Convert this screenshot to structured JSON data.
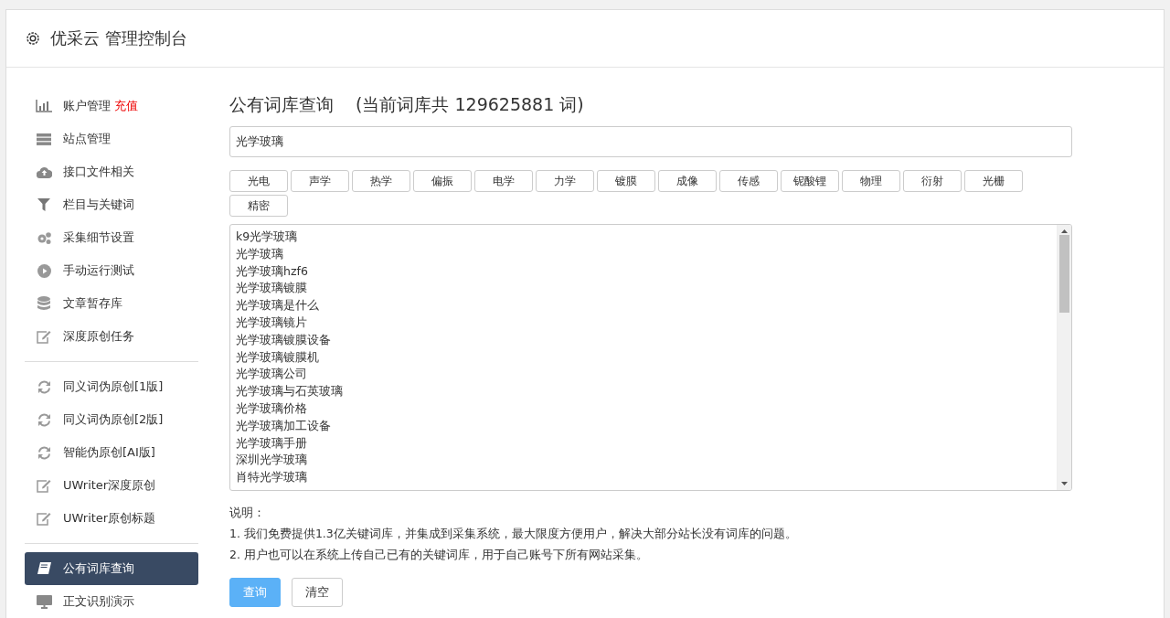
{
  "header": {
    "title": "优采云 管理控制台"
  },
  "sidebar": {
    "groups": [
      {
        "items": [
          {
            "kind": "chart",
            "label": "账户管理",
            "badge": "充值",
            "selected": false
          },
          {
            "kind": "server",
            "label": "站点管理",
            "selected": false
          },
          {
            "kind": "cloud",
            "label": "接口文件相关",
            "selected": false
          },
          {
            "kind": "filter",
            "label": "栏目与关键词",
            "selected": false
          },
          {
            "kind": "gears",
            "label": "采集细节设置",
            "selected": false
          },
          {
            "kind": "play",
            "label": "手动运行测试",
            "selected": false
          },
          {
            "kind": "db",
            "label": "文章暂存库",
            "selected": false
          },
          {
            "kind": "edit",
            "label": "深度原创任务",
            "selected": false
          }
        ]
      },
      {
        "items": [
          {
            "kind": "refresh",
            "label": "同义词伪原创[1版]",
            "selected": false
          },
          {
            "kind": "refresh",
            "label": "同义词伪原创[2版]",
            "selected": false
          },
          {
            "kind": "refresh",
            "label": "智能伪原创[AI版]",
            "selected": false
          },
          {
            "kind": "edit",
            "label": "UWriter深度原创",
            "selected": false
          },
          {
            "kind": "edit",
            "label": "UWriter原创标题",
            "selected": false
          }
        ]
      },
      {
        "items": [
          {
            "kind": "book",
            "label": "公有词库查询",
            "selected": true
          },
          {
            "kind": "monitor",
            "label": "正文识别演示",
            "selected": false
          }
        ]
      }
    ]
  },
  "main": {
    "title": "公有词库查询",
    "subtitle": "(当前词库共 129625881 词)",
    "search": {
      "value": "光学玻璃"
    },
    "tags": [
      "光电",
      "声学",
      "热学",
      "偏振",
      "电学",
      "力学",
      "镀膜",
      "成像",
      "传感",
      "铌酸锂",
      "物理",
      "衍射",
      "光栅",
      "精密"
    ],
    "results": [
      "k9光学玻璃",
      "光学玻璃",
      "光学玻璃hzf6",
      "光学玻璃镀膜",
      "光学玻璃是什么",
      "光学玻璃镜片",
      "光学玻璃镀膜设备",
      "光学玻璃镀膜机",
      "光学玻璃公司",
      "光学玻璃与石英玻璃",
      "光学玻璃价格",
      "光学玻璃加工设备",
      "光学玻璃手册",
      "深圳光学玻璃",
      "肖特光学玻璃"
    ],
    "notes_title": "说明：",
    "notes": [
      "1. 我们免费提供1.3亿关键词库，并集成到采集系统，最大限度方便用户，解决大部分站长没有词库的问题。",
      "2. 用户也可以在系统上传自己已有的关键词库，用于自己账号下所有网站采集。"
    ],
    "buttons": [
      {
        "kind": "primary",
        "label": "查询"
      },
      {
        "kind": "default",
        "label": "清空"
      }
    ]
  }
}
